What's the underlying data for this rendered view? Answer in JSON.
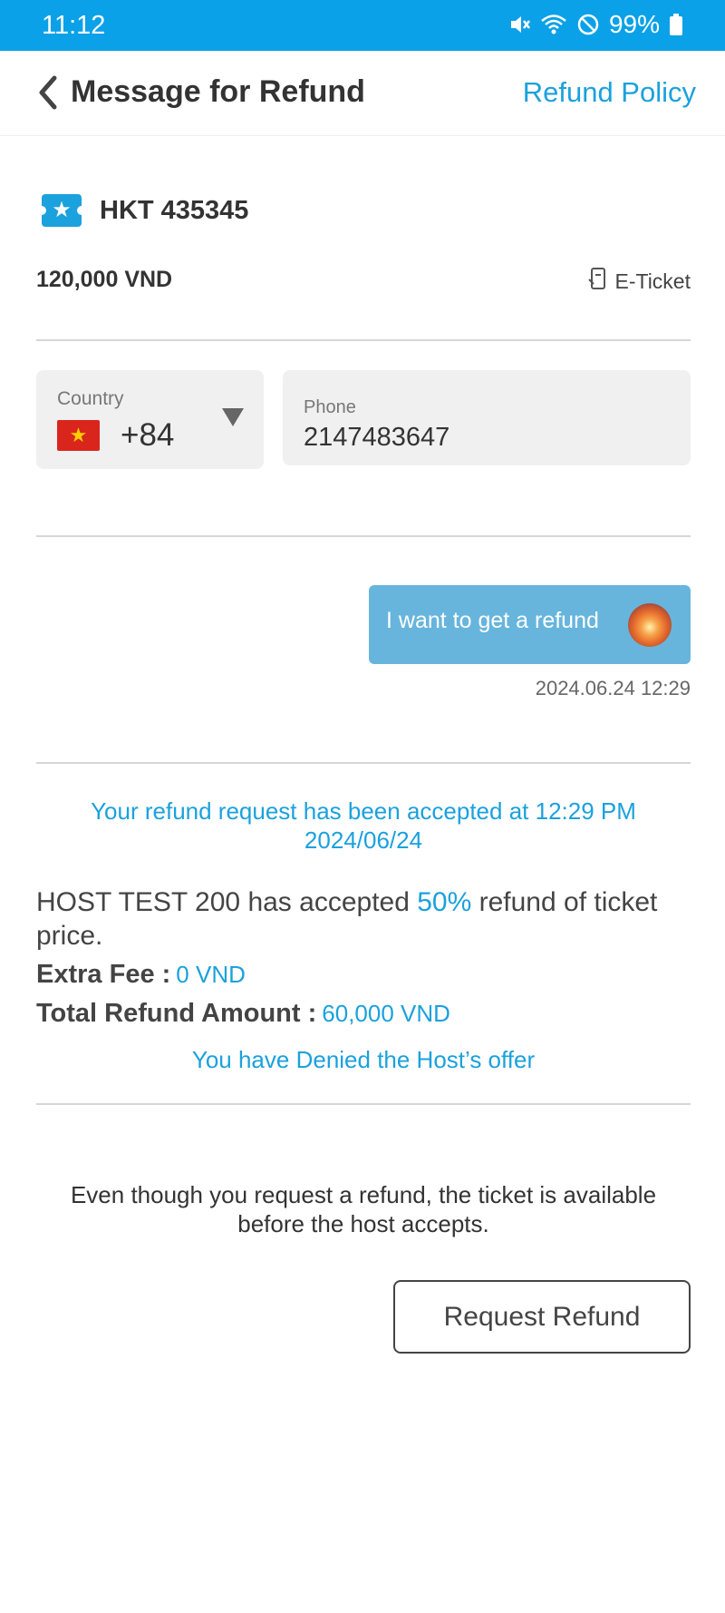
{
  "status_bar": {
    "time": "11:12",
    "battery": "99%",
    "icons": [
      "mute-icon",
      "wifi-icon",
      "do-not-disturb-icon",
      "battery-icon"
    ]
  },
  "header": {
    "title": "Message for Refund",
    "policy_link": "Refund Policy",
    "back_icon": "chevron-left-icon"
  },
  "ticket": {
    "code": "HKT 435345",
    "price": "120,000 VND",
    "type": "E-Ticket",
    "icon": "ticket-star-icon"
  },
  "contact": {
    "country_label": "Country",
    "dial_code": "+84",
    "flag": "vietnam-flag",
    "phone_label": "Phone",
    "phone_value": "2147483647"
  },
  "message": {
    "text": "I want to get a refund",
    "timestamp": "2024.06.24 12:29"
  },
  "refund": {
    "accepted_text": "Your refund request has been accepted at 12:29 PM 2024/06/24",
    "host_name": "HOST TEST 200 ",
    "accepted_phrase": " has accepted ",
    "percent": "50%",
    "price_phrase": " refund of ticket price.",
    "extra_fee_label": "Extra Fee :",
    "extra_fee_value": "0 VND",
    "total_label": "Total Refund Amount :",
    "total_value": "60,000 VND",
    "denied_text": "You have Denied the Host’s offer"
  },
  "notice": "Even though you request a refund, the ticket is available before the host accepts.",
  "actions": {
    "request_refund": "Request Refund"
  },
  "colors": {
    "status_bar": "#0aa1e8",
    "accent": "#1ba1dd",
    "bubble": "#67b5dd"
  }
}
